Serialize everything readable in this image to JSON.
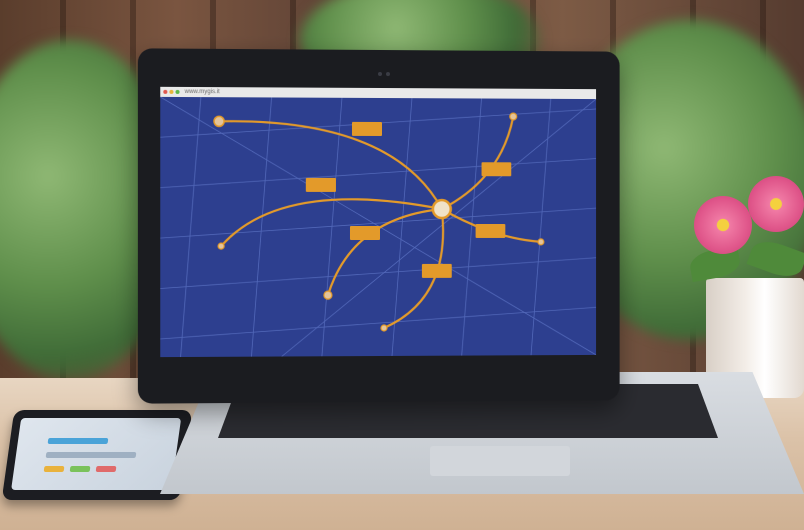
{
  "browser": {
    "url": "www.mygis.it"
  },
  "map": {
    "colors": {
      "background": "#2d3f8f",
      "route": "#e39a2a",
      "node": "#e4c49a"
    },
    "label_boxes": [
      {
        "id": "label-1"
      },
      {
        "id": "label-2"
      },
      {
        "id": "label-3"
      },
      {
        "id": "label-4"
      },
      {
        "id": "label-5"
      },
      {
        "id": "label-6"
      }
    ],
    "nodes": [
      {
        "id": "hub"
      },
      {
        "id": "node-top-left"
      },
      {
        "id": "node-top-right"
      },
      {
        "id": "node-left"
      },
      {
        "id": "node-bottom-left"
      },
      {
        "id": "node-bottom"
      },
      {
        "id": "node-right"
      }
    ]
  },
  "scene": {
    "description_icons": [
      "laptop-icon",
      "tablet-icon",
      "flower-pot-icon"
    ]
  }
}
